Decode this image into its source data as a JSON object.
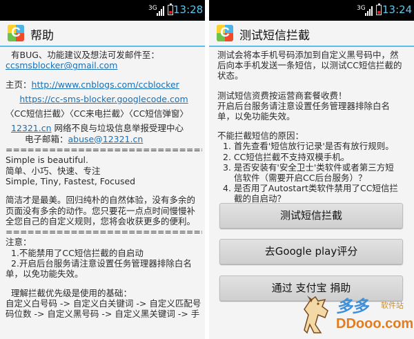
{
  "left": {
    "status": {
      "network": "3G",
      "time": "13:28"
    },
    "title": "帮助",
    "app_icon_letter": "C",
    "lines": [
      {
        "text": "有BUG、功能建议及想法可发邮件至：",
        "kind": "ind1"
      },
      {
        "text": "ccsmsblocker@gmail.com",
        "kind": "link"
      },
      {
        "kind": "gap"
      },
      {
        "prefix": "主页：",
        "link": "http://www.cnblogs.com/ccblocker",
        "kind": "mixed-link"
      },
      {
        "kind": "sgap"
      },
      {
        "text": "https://cc-sms-blocker.googlecode.com",
        "kind": "link-center"
      },
      {
        "kind": "sgap"
      },
      {
        "text": "〈CC短信拦截〉〈CC来电拦截〉〈CC短信弹窗〉",
        "kind": "plain"
      },
      {
        "kind": "sgap"
      },
      {
        "link": "12321.cn",
        "suffix": " 网络不良与垃圾信息举报受理中心",
        "kind": "link-mixed"
      },
      {
        "prefix": "电子邮箱：",
        "link": "abuse@12321.cn",
        "kind": "mixed-link-ind"
      },
      {
        "text": "======================================",
        "kind": "plain"
      },
      {
        "text": "Simple is beautiful.",
        "kind": "plain"
      },
      {
        "text": "简单、小巧、快速、专注",
        "kind": "plain"
      },
      {
        "text": "Simple, Tiny, Fastest, Focused",
        "kind": "plain"
      },
      {
        "kind": "gap"
      },
      {
        "text": "简洁才是最美。回归纯朴的自然体验，没有多余的",
        "kind": "plain"
      },
      {
        "text": "页面没有多余的动作。您只要花一点点时间慢慢补",
        "kind": "plain"
      },
      {
        "text": "全您自己的自定义规则，您将会收获更多的便利。",
        "kind": "plain"
      },
      {
        "text": "======================================",
        "kind": "plain"
      },
      {
        "text": "注意：",
        "kind": "plain"
      },
      {
        "text": "1.不能禁用了CC短信拦截的自启动",
        "kind": "ind1"
      },
      {
        "text": "2.开启后台服务请注意设置任务管理器排除白名",
        "kind": "ind1"
      },
      {
        "text": "单，以免功能失效。",
        "kind": "plain"
      },
      {
        "kind": "gap"
      },
      {
        "text": "理解拦截优先级是使用的基础：",
        "kind": "ind1"
      },
      {
        "text": "自定义白号码 -> 自定义白关键词 -> 自定义匹配号",
        "kind": "plain"
      },
      {
        "text": "码位数 -> 自定义黑号码 -> 自定义黑关键词 -> 手",
        "kind": "plain"
      }
    ]
  },
  "right": {
    "status": {
      "network": "3G",
      "time": "13:24"
    },
    "title": "测试短信拦截",
    "app_icon_letter": "C",
    "lines": [
      {
        "text": "测试会将本手机号码添加到自定义黑号码中，然",
        "kind": "plain"
      },
      {
        "text": "后向本手机发送一条短信，以测试CC短信拦截的",
        "kind": "plain"
      },
      {
        "text": "状态。",
        "kind": "plain"
      },
      {
        "kind": "gap"
      },
      {
        "text": "测试短信资费按运营商套餐收费！",
        "kind": "plain"
      },
      {
        "text": "开启后台服务请注意设置任务管理器排除白名",
        "kind": "plain"
      },
      {
        "text": "单，以免功能失效。",
        "kind": "plain"
      },
      {
        "kind": "gap"
      },
      {
        "text": "不能拦截短信的原因：",
        "kind": "plain"
      },
      {
        "text": "1. 首先查看'短信放行记录'是否有放行规则。",
        "kind": "ind1"
      },
      {
        "text": "2. CC短信拦截不支持双模手机。",
        "kind": "ind1"
      },
      {
        "text": "3. 是否安装有'安全卫士'类软件或者第三方短",
        "kind": "ind1"
      },
      {
        "text": "信软件（需要开启CC后台服务）？",
        "kind": "ind2"
      },
      {
        "text": "4. 是否用了Autostart类软件禁用了CC短信拦",
        "kind": "ind1"
      },
      {
        "text": "截的自启动？",
        "kind": "ind2"
      }
    ],
    "buttons": {
      "test": "测试短信拦截",
      "rate": "去Google play评分",
      "donate": "通过 支付宝 捐助"
    }
  },
  "watermark": {
    "title": "多多",
    "subtitle": "软件站",
    "domain": "DDooo.com"
  },
  "colors": {
    "accent": "#55c1ea",
    "link": "#1a6fb5",
    "clock": "#5ec8f0",
    "battery_low": "#e02020"
  },
  "icons": {
    "app": "cc-sms-blocker-app-icon",
    "signal": "signal-bars-icon",
    "battery": "battery-low-icon",
    "watermark": "horse-logo-icon"
  }
}
